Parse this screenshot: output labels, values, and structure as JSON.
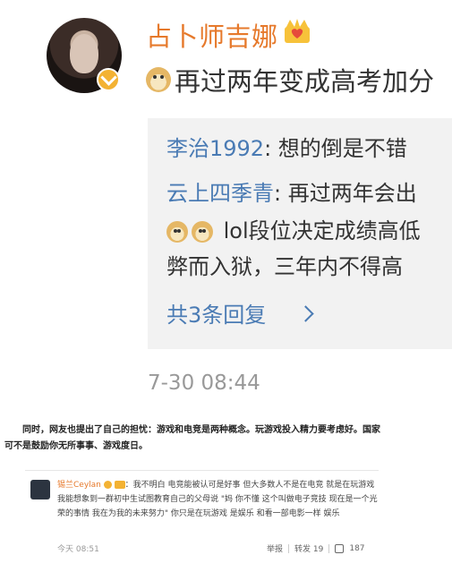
{
  "post": {
    "username": "占卜师吉娜",
    "text": "再过两年变成高考加分",
    "replies": [
      {
        "user": "李治1992",
        "text": ": 想的倒是不错"
      },
      {
        "user": "云上四季青",
        "text": ": 再过两年会出"
      },
      {
        "user": "",
        "text": "lol段位决定成绩高低"
      },
      {
        "user": "",
        "text": "弊而入狱，三年内不得高"
      }
    ],
    "more_replies_label": "共3条回复",
    "timestamp": "7-30 08:44"
  },
  "caption": "同时，网友也提出了自己的担忧：游戏和电竞是两种概念。玩游戏投入精力要考虑好。国家可不是鼓励你无所事事、游戏度日。",
  "mini_comment": {
    "username": "锡兰Ceylan",
    "text": "：我不明白 电竞能被认可是好事 但大多数人不是在电竞 就是在玩游戏 我能想象到一群初中生试图教育自己的父母说 \"妈 你不懂 这个叫做电子竞技 现在是一个光荣的事情 我在为我的未来努力\" 你只是在玩游戏 是娱乐 和看一部电影一样 娱乐",
    "time": "今天 08:51",
    "report_label": "举报",
    "forward_label": "转发 19",
    "like_count": "187"
  },
  "colors": {
    "username": "#e6792b",
    "link": "#4a7bb4",
    "reply_bg": "#f2f2f2"
  }
}
